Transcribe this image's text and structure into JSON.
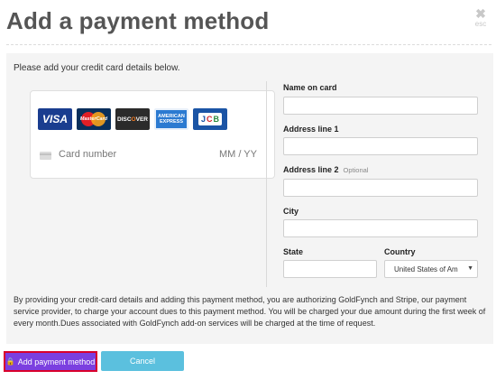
{
  "modal": {
    "title": "Add a payment method",
    "close_glyph": "✖",
    "close_hint": "esc"
  },
  "intro": "Please add your credit card details below.",
  "card": {
    "logos": [
      {
        "name": "visa-logo",
        "label": "VISA"
      },
      {
        "name": "mastercard-logo",
        "label": "MasterCard"
      },
      {
        "name": "discover-logo",
        "label": "DISCOVER"
      },
      {
        "name": "amex-logo",
        "label": "AMERICAN EXPRESS"
      },
      {
        "name": "jcb-logo",
        "label": "JCB"
      }
    ],
    "number_placeholder": "Card number",
    "expiry_placeholder": "MM / YY"
  },
  "form": {
    "name_label": "Name on card",
    "address1_label": "Address line 1",
    "address2_label": "Address line 2",
    "optional_label": "Optional",
    "city_label": "City",
    "state_label": "State",
    "country_label": "Country",
    "country_value": "United States of Am",
    "country_options": [
      "United States of Am"
    ]
  },
  "legal_text": "By providing your credit-card details and adding this payment method, you are authorizing GoldFynch and Stripe, our payment service provider, to charge your account dues to this payment method. You will be charged your due amount during the first week of every month.Dues associated with GoldFynch add-on services will be charged at the time of request.",
  "buttons": {
    "add_label": "Add payment method",
    "cancel_label": "Cancel"
  },
  "colors": {
    "primary": "#7b3fe0",
    "cancel": "#5bc0de",
    "focus_outline": "#d9002c"
  }
}
